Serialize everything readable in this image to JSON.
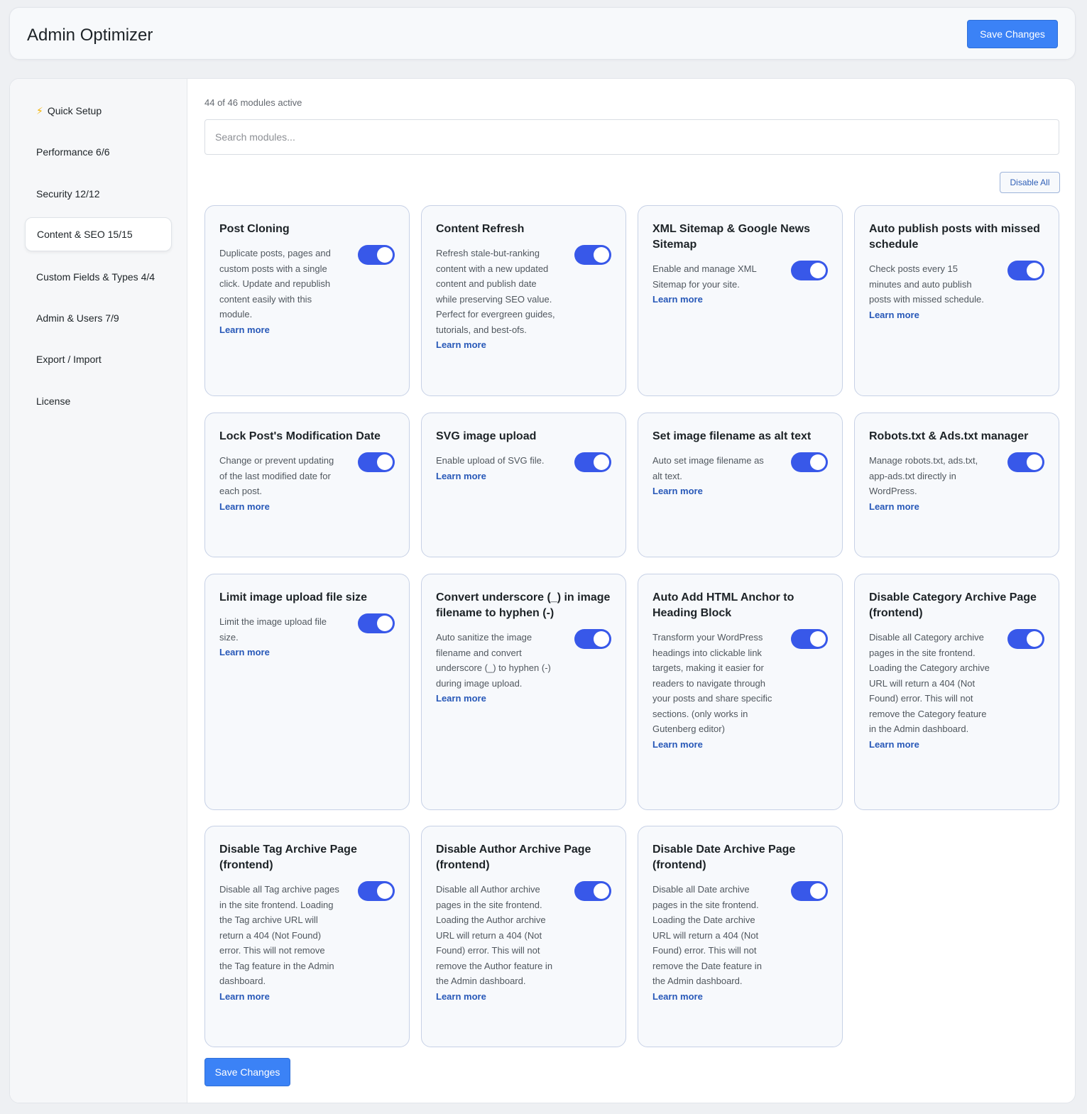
{
  "header": {
    "title": "Admin Optimizer",
    "save_label": "Save Changes"
  },
  "sidebar": {
    "items": [
      {
        "label": "Quick Setup",
        "icon": "lightning-icon",
        "active": false
      },
      {
        "label": "Performance 6/6",
        "active": false
      },
      {
        "label": "Security 12/12",
        "active": false
      },
      {
        "label": "Content & SEO 15/15",
        "active": true
      },
      {
        "label": "Custom Fields & Types 4/4",
        "active": false
      },
      {
        "label": "Admin & Users 7/9",
        "active": false
      },
      {
        "label": "Export / Import",
        "active": false
      },
      {
        "label": "License",
        "active": false
      }
    ]
  },
  "main": {
    "count": "44 of 46 modules active",
    "search_placeholder": "Search modules...",
    "disable_all": "Disable All",
    "learn_more": "Learn more",
    "bottom_save": "Save Changes",
    "toggle_color": "#3858e9",
    "modules": [
      {
        "title": "Post Cloning",
        "desc": "Duplicate posts, pages and custom posts with a single click. Update and republish content easily with this module.",
        "enabled": true
      },
      {
        "title": "Content Refresh",
        "desc": "Refresh stale-but-ranking content with a new updated content and publish date while preserving SEO value. Perfect for evergreen guides, tutorials, and best-ofs.",
        "enabled": true
      },
      {
        "title": "XML Sitemap & Google News Sitemap",
        "desc": "Enable and manage XML Sitemap for your site.",
        "enabled": true
      },
      {
        "title": "Auto publish posts with missed schedule",
        "desc": "Check posts every 15 minutes and auto publish posts with missed schedule.",
        "enabled": true
      },
      {
        "title": "Lock Post's Modification Date",
        "desc": "Change or prevent updating of the last modified date for each post.",
        "enabled": true
      },
      {
        "title": "SVG image upload",
        "desc": "Enable upload of SVG file.",
        "enabled": true
      },
      {
        "title": "Set image filename as alt text",
        "desc": "Auto set image filename as alt text.",
        "enabled": true
      },
      {
        "title": "Robots.txt & Ads.txt manager",
        "desc": "Manage robots.txt, ads.txt, app-ads.txt directly in WordPress.",
        "enabled": true
      },
      {
        "title": "Limit image upload file size",
        "desc": "Limit the image upload file size.",
        "enabled": true
      },
      {
        "title": "Convert underscore (_) in image filename to hyphen (-)",
        "desc": "Auto sanitize the image filename and convert underscore (_) to hyphen (-) during image upload.",
        "enabled": true
      },
      {
        "title": "Auto Add HTML Anchor to Heading Block",
        "desc": "Transform your WordPress headings into clickable link targets, making it easier for readers to navigate through your posts and share specific sections. (only works in Gutenberg editor)",
        "enabled": true
      },
      {
        "title": "Disable Category Archive Page (frontend)",
        "desc": "Disable all Category archive pages in the site frontend. Loading the Category archive URL will return a 404 (Not Found) error. This will not remove the Category feature in the Admin dashboard.",
        "enabled": true
      },
      {
        "title": "Disable Tag Archive Page (frontend)",
        "desc": "Disable all Tag archive pages in the site frontend. Loading the Tag archive URL will return a 404 (Not Found) error. This will not remove the Tag feature in the Admin dashboard.",
        "enabled": true
      },
      {
        "title": "Disable Author Archive Page (frontend)",
        "desc": "Disable all Author archive pages in the site frontend. Loading the Author archive URL will return a 404 (Not Found) error. This will not remove the Author feature in the Admin dashboard.",
        "enabled": true
      },
      {
        "title": "Disable Date Archive Page (frontend)",
        "desc": "Disable all Date archive pages in the site frontend. Loading the Date archive URL will return a 404 (Not Found) error. This will not remove the Date feature in the Admin dashboard.",
        "enabled": true
      }
    ]
  }
}
